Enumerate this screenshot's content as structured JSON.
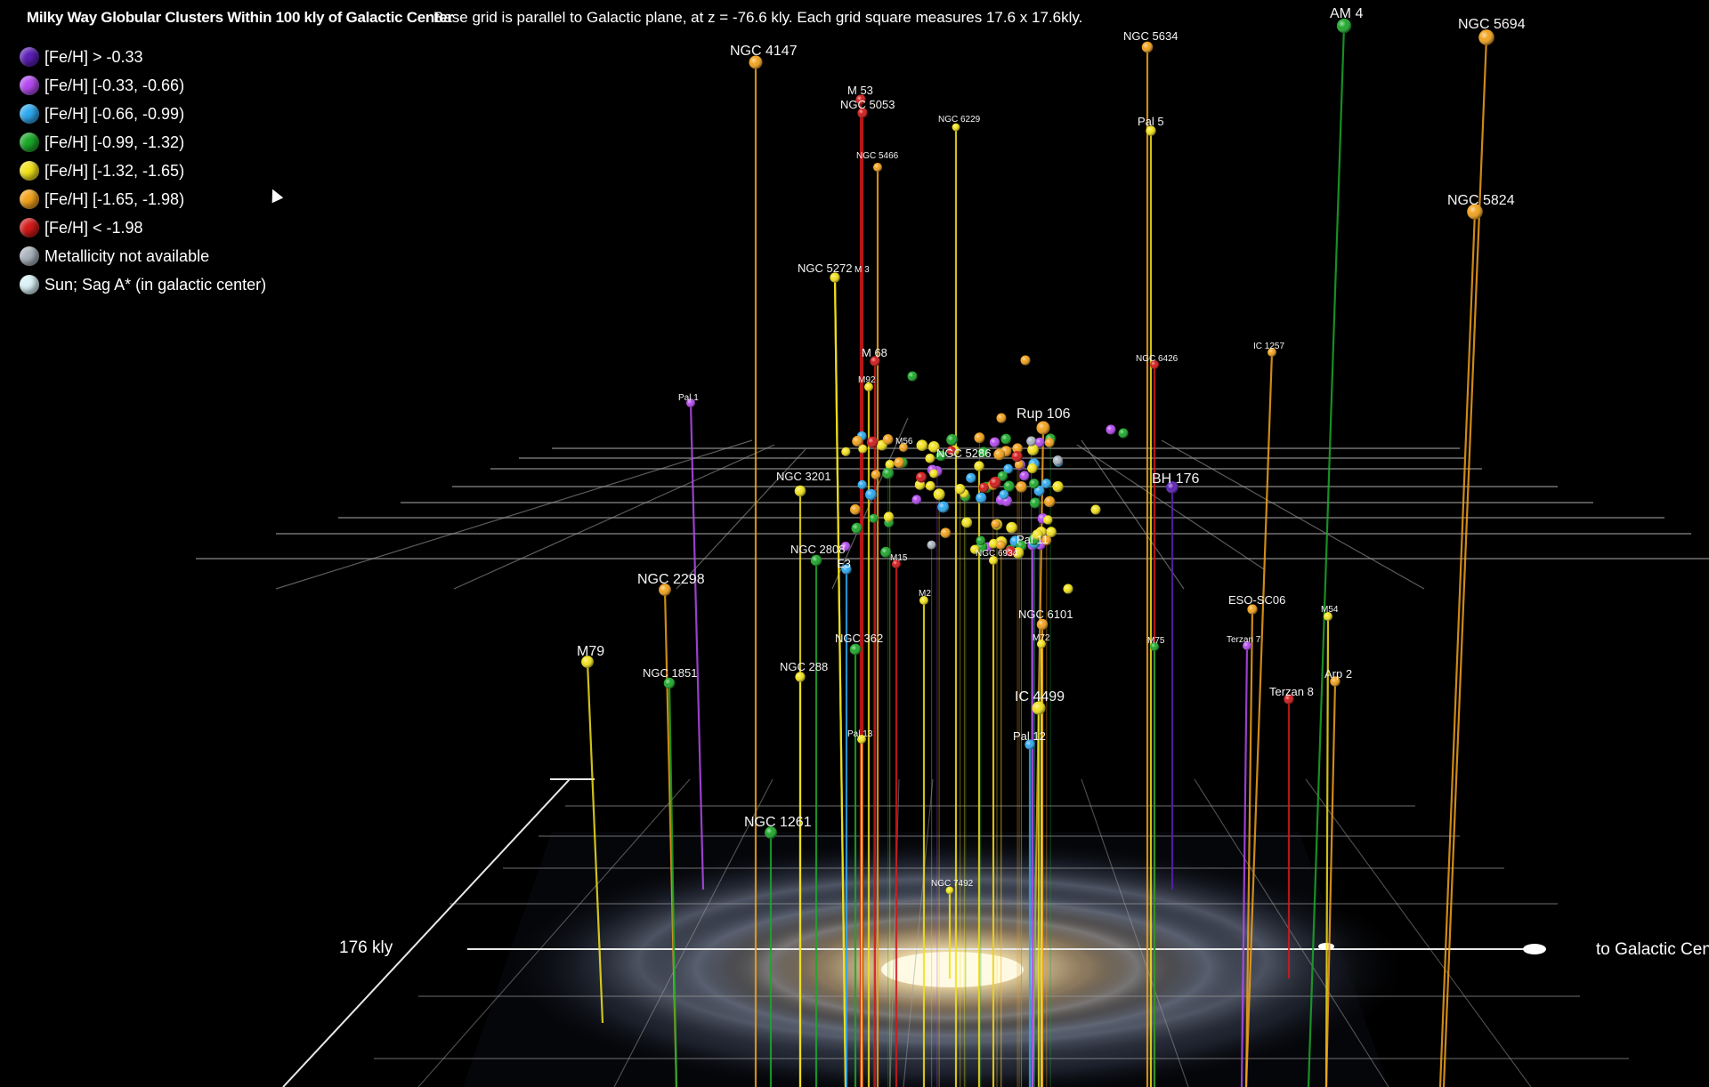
{
  "header": {
    "title": "Milky Way Globular Clusters Within 100 kly of Galactic Center",
    "subtitle": "Base grid is parallel to Galactic plane, at z = -76.6 kly. Each grid square measures 17.6 x 17.6kly."
  },
  "legend": [
    {
      "label": "[Fe/H] > -0.33",
      "color": "#5b1fb5"
    },
    {
      "label": "[Fe/H] [-0.33, -0.66)",
      "color": "#b44bf0"
    },
    {
      "label": "[Fe/H] [-0.66, -0.99)",
      "color": "#2fa9f0"
    },
    {
      "label": "[Fe/H] [-0.99, -1.32)",
      "color": "#1ca82a"
    },
    {
      "label": "[Fe/H] [-1.32, -1.65)",
      "color": "#f2e21c"
    },
    {
      "label": "[Fe/H] [-1.65, -1.98)",
      "color": "#f2a21c"
    },
    {
      "label": "[Fe/H] < -1.98",
      "color": "#d21a1a"
    },
    {
      "label": "Metallicity not available",
      "color": "#a9b2bd"
    },
    {
      "label": "Sun; Sag A* (in galactic center)",
      "color": "#d9f2f7"
    }
  ],
  "axes": {
    "scale_label": "176 kly",
    "direction_label": "to Galactic Center"
  },
  "chart_data": {
    "type": "scatter",
    "title": "Milky Way Globular Clusters Within 100 kly of Galactic Center",
    "subtitle": "Base grid is parallel to Galactic plane, at z = -76.6 kly. Each grid square measures 17.6 x 17.6kly.",
    "grid": true,
    "legend_position": "top-left",
    "projection": "3d-perspective",
    "labeled_clusters": [
      {
        "name": "NGC 4147",
        "bin": 5
      },
      {
        "name": "M 53",
        "bin": 6
      },
      {
        "name": "NGC 5053",
        "bin": 6
      },
      {
        "name": "NGC 6229",
        "bin": 4
      },
      {
        "name": "NGC 5466",
        "bin": 5
      },
      {
        "name": "NGC 5634",
        "bin": 5
      },
      {
        "name": "Pal 5",
        "bin": 4
      },
      {
        "name": "AM 4",
        "bin": 3
      },
      {
        "name": "NGC 5694",
        "bin": 5
      },
      {
        "name": "NGC 5824",
        "bin": 5
      },
      {
        "name": "NGC 5272",
        "bin": 4
      },
      {
        "name": "M 3",
        "bin": 4
      },
      {
        "name": "M 68",
        "bin": 6
      },
      {
        "name": "M92",
        "bin": 4
      },
      {
        "name": "NGC 6426",
        "bin": 6
      },
      {
        "name": "IC 1257",
        "bin": 5
      },
      {
        "name": "Pal 1",
        "bin": 1
      },
      {
        "name": "Rup 106",
        "bin": 5
      },
      {
        "name": "M56",
        "bin": 5
      },
      {
        "name": "NGC 5286",
        "bin": 4
      },
      {
        "name": "NGC 3201",
        "bin": 4
      },
      {
        "name": "BH 176",
        "bin": 0
      },
      {
        "name": "Pal 11",
        "bin": 1
      },
      {
        "name": "NGC 2808",
        "bin": 3
      },
      {
        "name": "E3",
        "bin": 2
      },
      {
        "name": "M15",
        "bin": 6
      },
      {
        "name": "NGC 6934",
        "bin": 4
      },
      {
        "name": "NGC 2298",
        "bin": 5
      },
      {
        "name": "M2",
        "bin": 4
      },
      {
        "name": "NGC 6101",
        "bin": 5
      },
      {
        "name": "ESO-SC06",
        "bin": 5
      },
      {
        "name": "M54",
        "bin": 4
      },
      {
        "name": "M79",
        "bin": 4
      },
      {
        "name": "NGC 362",
        "bin": 3
      },
      {
        "name": "M72",
        "bin": 4
      },
      {
        "name": "M75",
        "bin": 3
      },
      {
        "name": "Terzan 7",
        "bin": 1
      },
      {
        "name": "NGC 1851",
        "bin": 3
      },
      {
        "name": "NGC 288",
        "bin": 4
      },
      {
        "name": "Arp 2",
        "bin": 5
      },
      {
        "name": "Terzan 8",
        "bin": 6
      },
      {
        "name": "IC 4499",
        "bin": 4
      },
      {
        "name": "Pal 13",
        "bin": 4
      },
      {
        "name": "Pal 12",
        "bin": 2
      },
      {
        "name": "NGC 1261",
        "bin": 3
      },
      {
        "name": "NGC 7492",
        "bin": 4
      }
    ],
    "cluster_bins_unlabeled_counts": {
      "0": 0,
      "1": 16,
      "2": 14,
      "3": 22,
      "4": 30,
      "5": 18,
      "6": 7,
      "7": 3
    }
  }
}
